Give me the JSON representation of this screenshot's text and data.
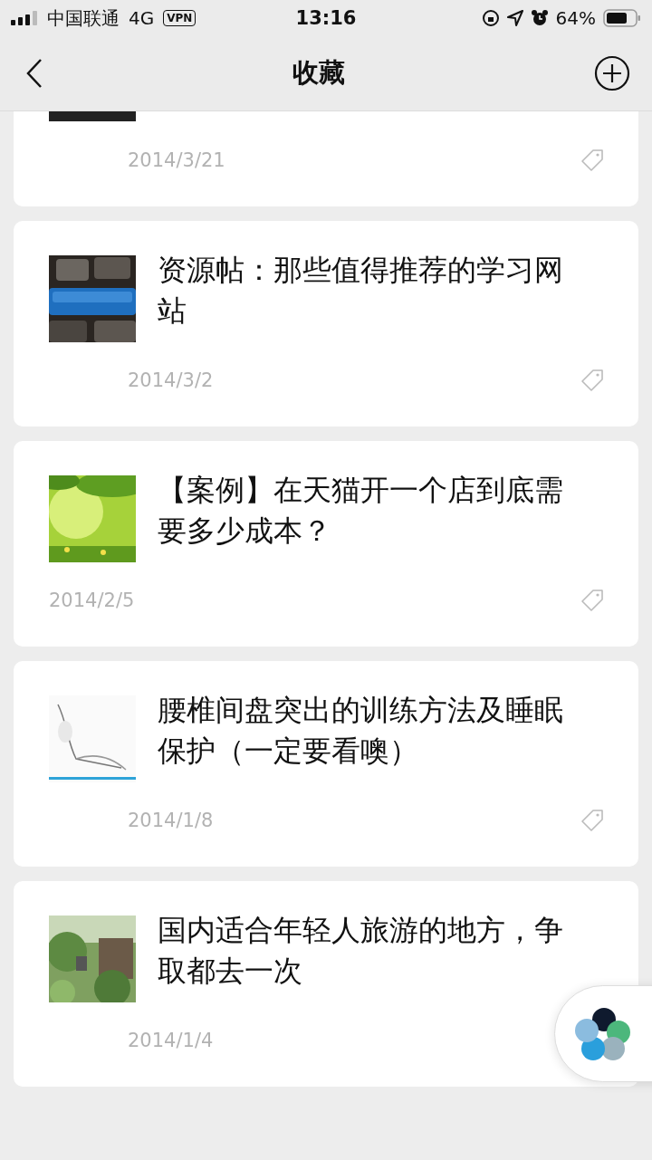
{
  "status_bar": {
    "carrier": "中国联通",
    "network": "4G",
    "vpn": "VPN",
    "time": "13:16",
    "battery": "64%"
  },
  "nav": {
    "title": "收藏"
  },
  "favorites": [
    {
      "kind": "partial",
      "date": "2014/3/21",
      "tag_icon": true
    },
    {
      "kind": "indented",
      "title": "资源帖：那些值得推荐的学习网站",
      "date": "2014/3/2",
      "tag_icon": true
    },
    {
      "kind": "flush",
      "title": "【案例】在天猫开一个店到底需要多少成本？",
      "date": "2014/2/5",
      "tag_icon": true
    },
    {
      "kind": "indented",
      "title": "腰椎间盘突出的训练方法及睡眠保护（一定要看噢）",
      "date": "2014/1/8",
      "tag_icon": true
    },
    {
      "kind": "indented",
      "title": "国内适合年轻人旅游的地方，争取都去一次",
      "date": "2014/1/4"
    }
  ]
}
